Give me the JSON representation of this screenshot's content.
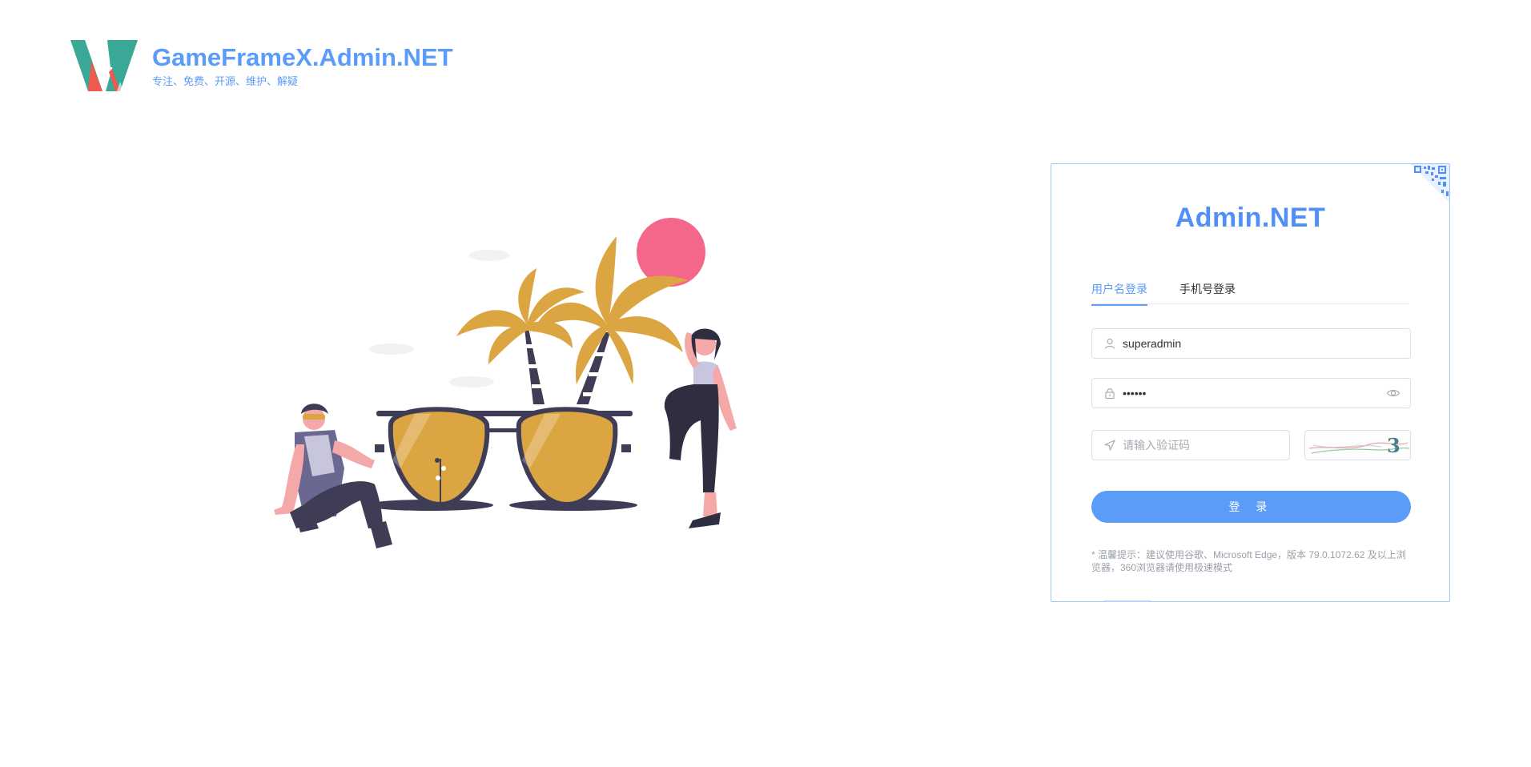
{
  "brand": {
    "title": "GameFrameX.Admin.NET",
    "subtitle": "专注、免费、开源、维护、解疑",
    "logo_colors": [
      "#3aa897",
      "#ef5a4f"
    ]
  },
  "login_card": {
    "title": "Admin.NET",
    "corner_icon": "qrcode-icon",
    "tabs": [
      {
        "label": "用户名登录",
        "active": true
      },
      {
        "label": "手机号登录",
        "active": false
      }
    ],
    "username": {
      "value": "superadmin",
      "icon": "user-icon"
    },
    "password": {
      "value": "123456",
      "icon": "lock-icon",
      "toggle_icon": "eye-icon"
    },
    "captcha": {
      "value": "",
      "placeholder": "请输入验证码",
      "icon": "location-arrow-icon",
      "image_text": "3"
    },
    "submit_label": "登 录",
    "tip": "* 温馨提示：建议使用谷歌、Microsoft Edge，版本 79.0.1072.62 及以上浏览器，360浏览器请使用极速模式"
  },
  "colors": {
    "accent": "#5a9cf8",
    "palm": "#dba542",
    "sun": "#f5668b",
    "dark": "#3f3d56"
  }
}
